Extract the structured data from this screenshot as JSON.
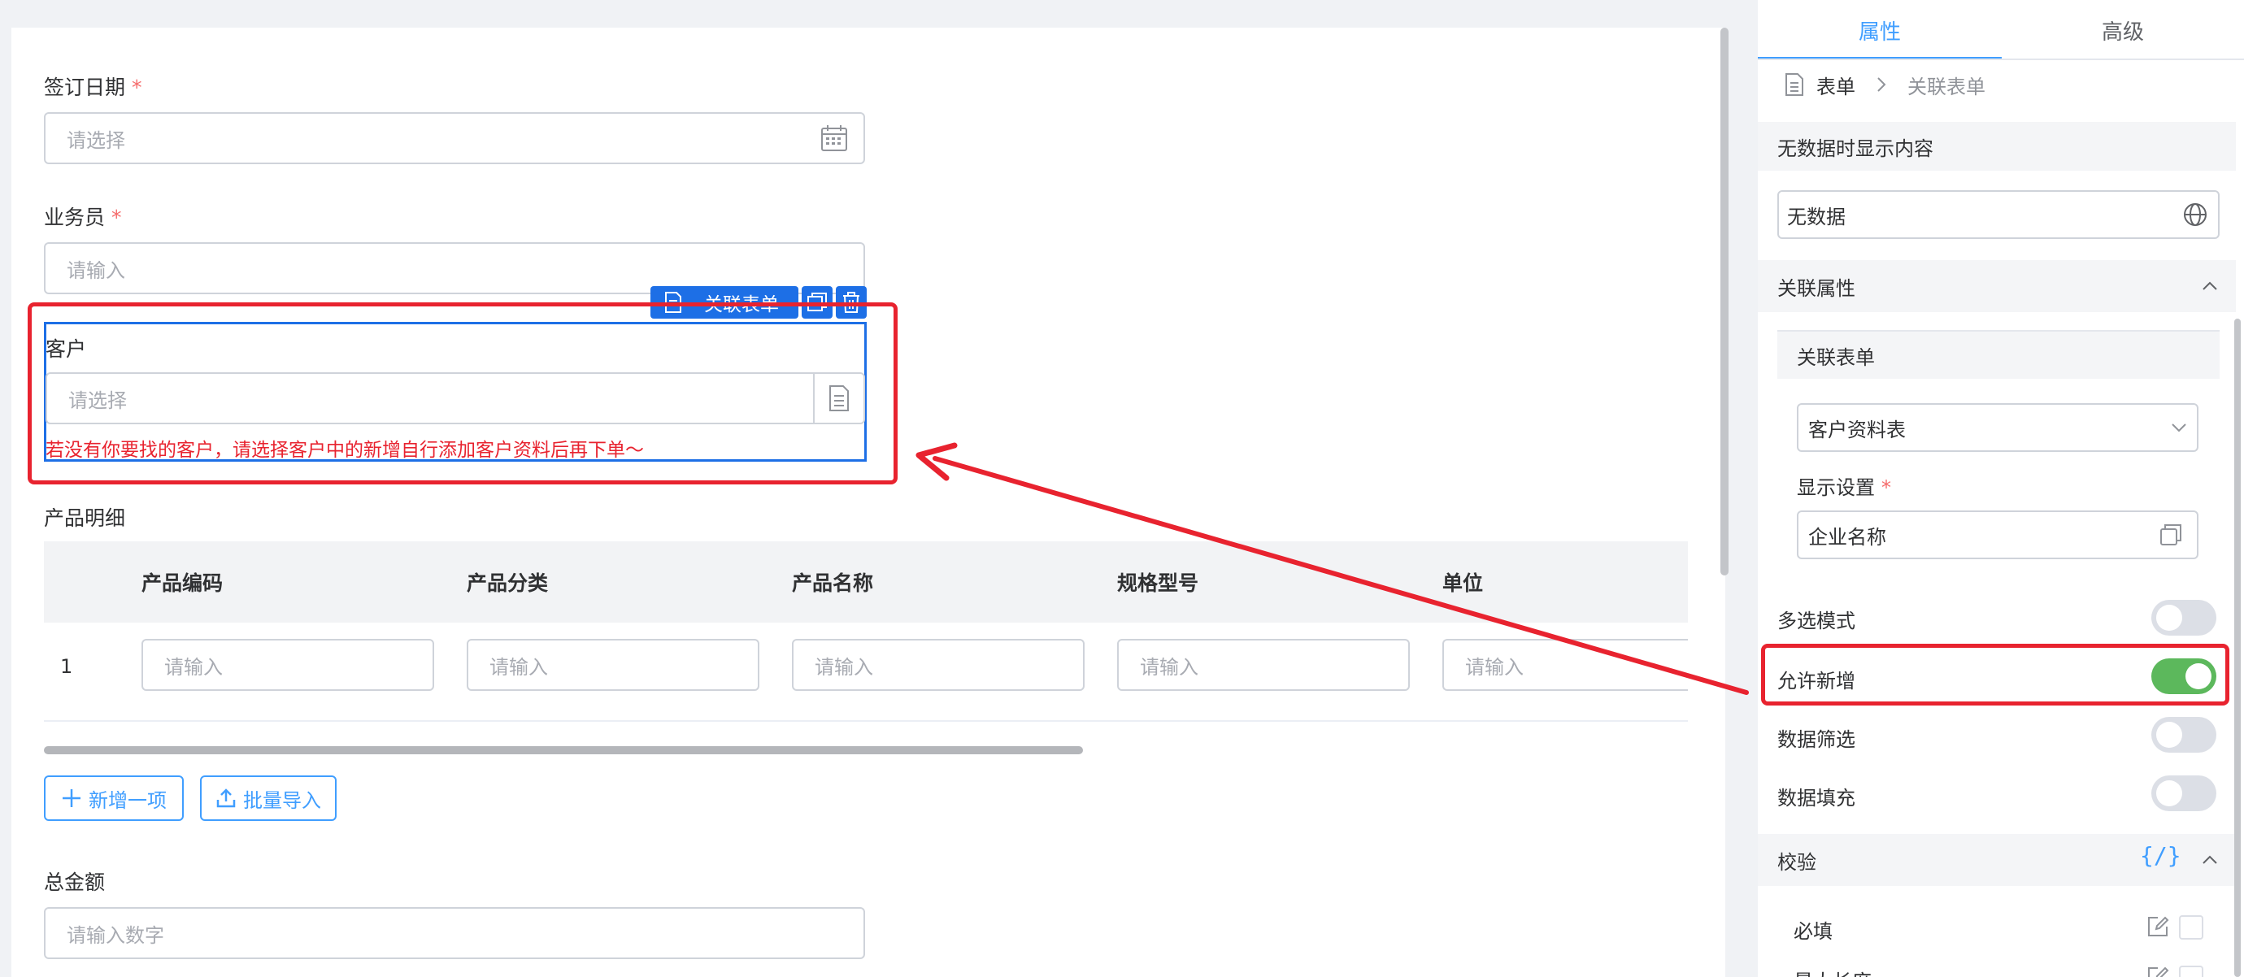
{
  "form": {
    "sign_date": {
      "label": "签订日期",
      "required_mark": "*",
      "placeholder": "请选择"
    },
    "salesperson": {
      "label": "业务员",
      "required_mark": "*",
      "placeholder": "请输入"
    },
    "selected_toolbar": {
      "tag_label": "关联表单"
    },
    "customer": {
      "label": "客户",
      "placeholder": "请选择",
      "hint": "若没有你要找的客户，请选择客户中的新增自行添加客户资料后再下单～"
    },
    "product_detail": {
      "label": "产品明细",
      "columns": [
        "产品编码",
        "产品分类",
        "产品名称",
        "规格型号",
        "单位"
      ],
      "rows": [
        {
          "index": "1",
          "cells": [
            "请输入",
            "请输入",
            "请输入",
            "请输入",
            "请输入"
          ]
        }
      ],
      "add_button": "新增一项",
      "import_button": "批量导入"
    },
    "total_amount": {
      "label": "总金额",
      "placeholder": "请输入数字"
    }
  },
  "panel": {
    "tabs": [
      "属性",
      "高级"
    ],
    "active_tab": "属性",
    "breadcrumb": [
      "表单",
      "关联表单"
    ],
    "no_data": {
      "title": "无数据时显示内容",
      "value": "无数据"
    },
    "relation": {
      "title": "关联属性",
      "subtitle": "关联表单",
      "form_value": "客户资料表",
      "display_label": "显示设置",
      "display_required": "*",
      "display_value": "企业名称"
    },
    "toggles": [
      {
        "label": "多选模式",
        "on": false
      },
      {
        "label": "允许新增",
        "on": true
      },
      {
        "label": "数据筛选",
        "on": false
      },
      {
        "label": "数据填充",
        "on": false
      }
    ],
    "validation": {
      "title": "校验",
      "code_symbol": "{/}",
      "required_label": "必填",
      "maxlen_label": "最大长度"
    }
  },
  "colors": {
    "accent": "#409eff",
    "annotation": "#e8232f",
    "toggle_on": "#5cb85c",
    "error_text": "#e8232f"
  }
}
